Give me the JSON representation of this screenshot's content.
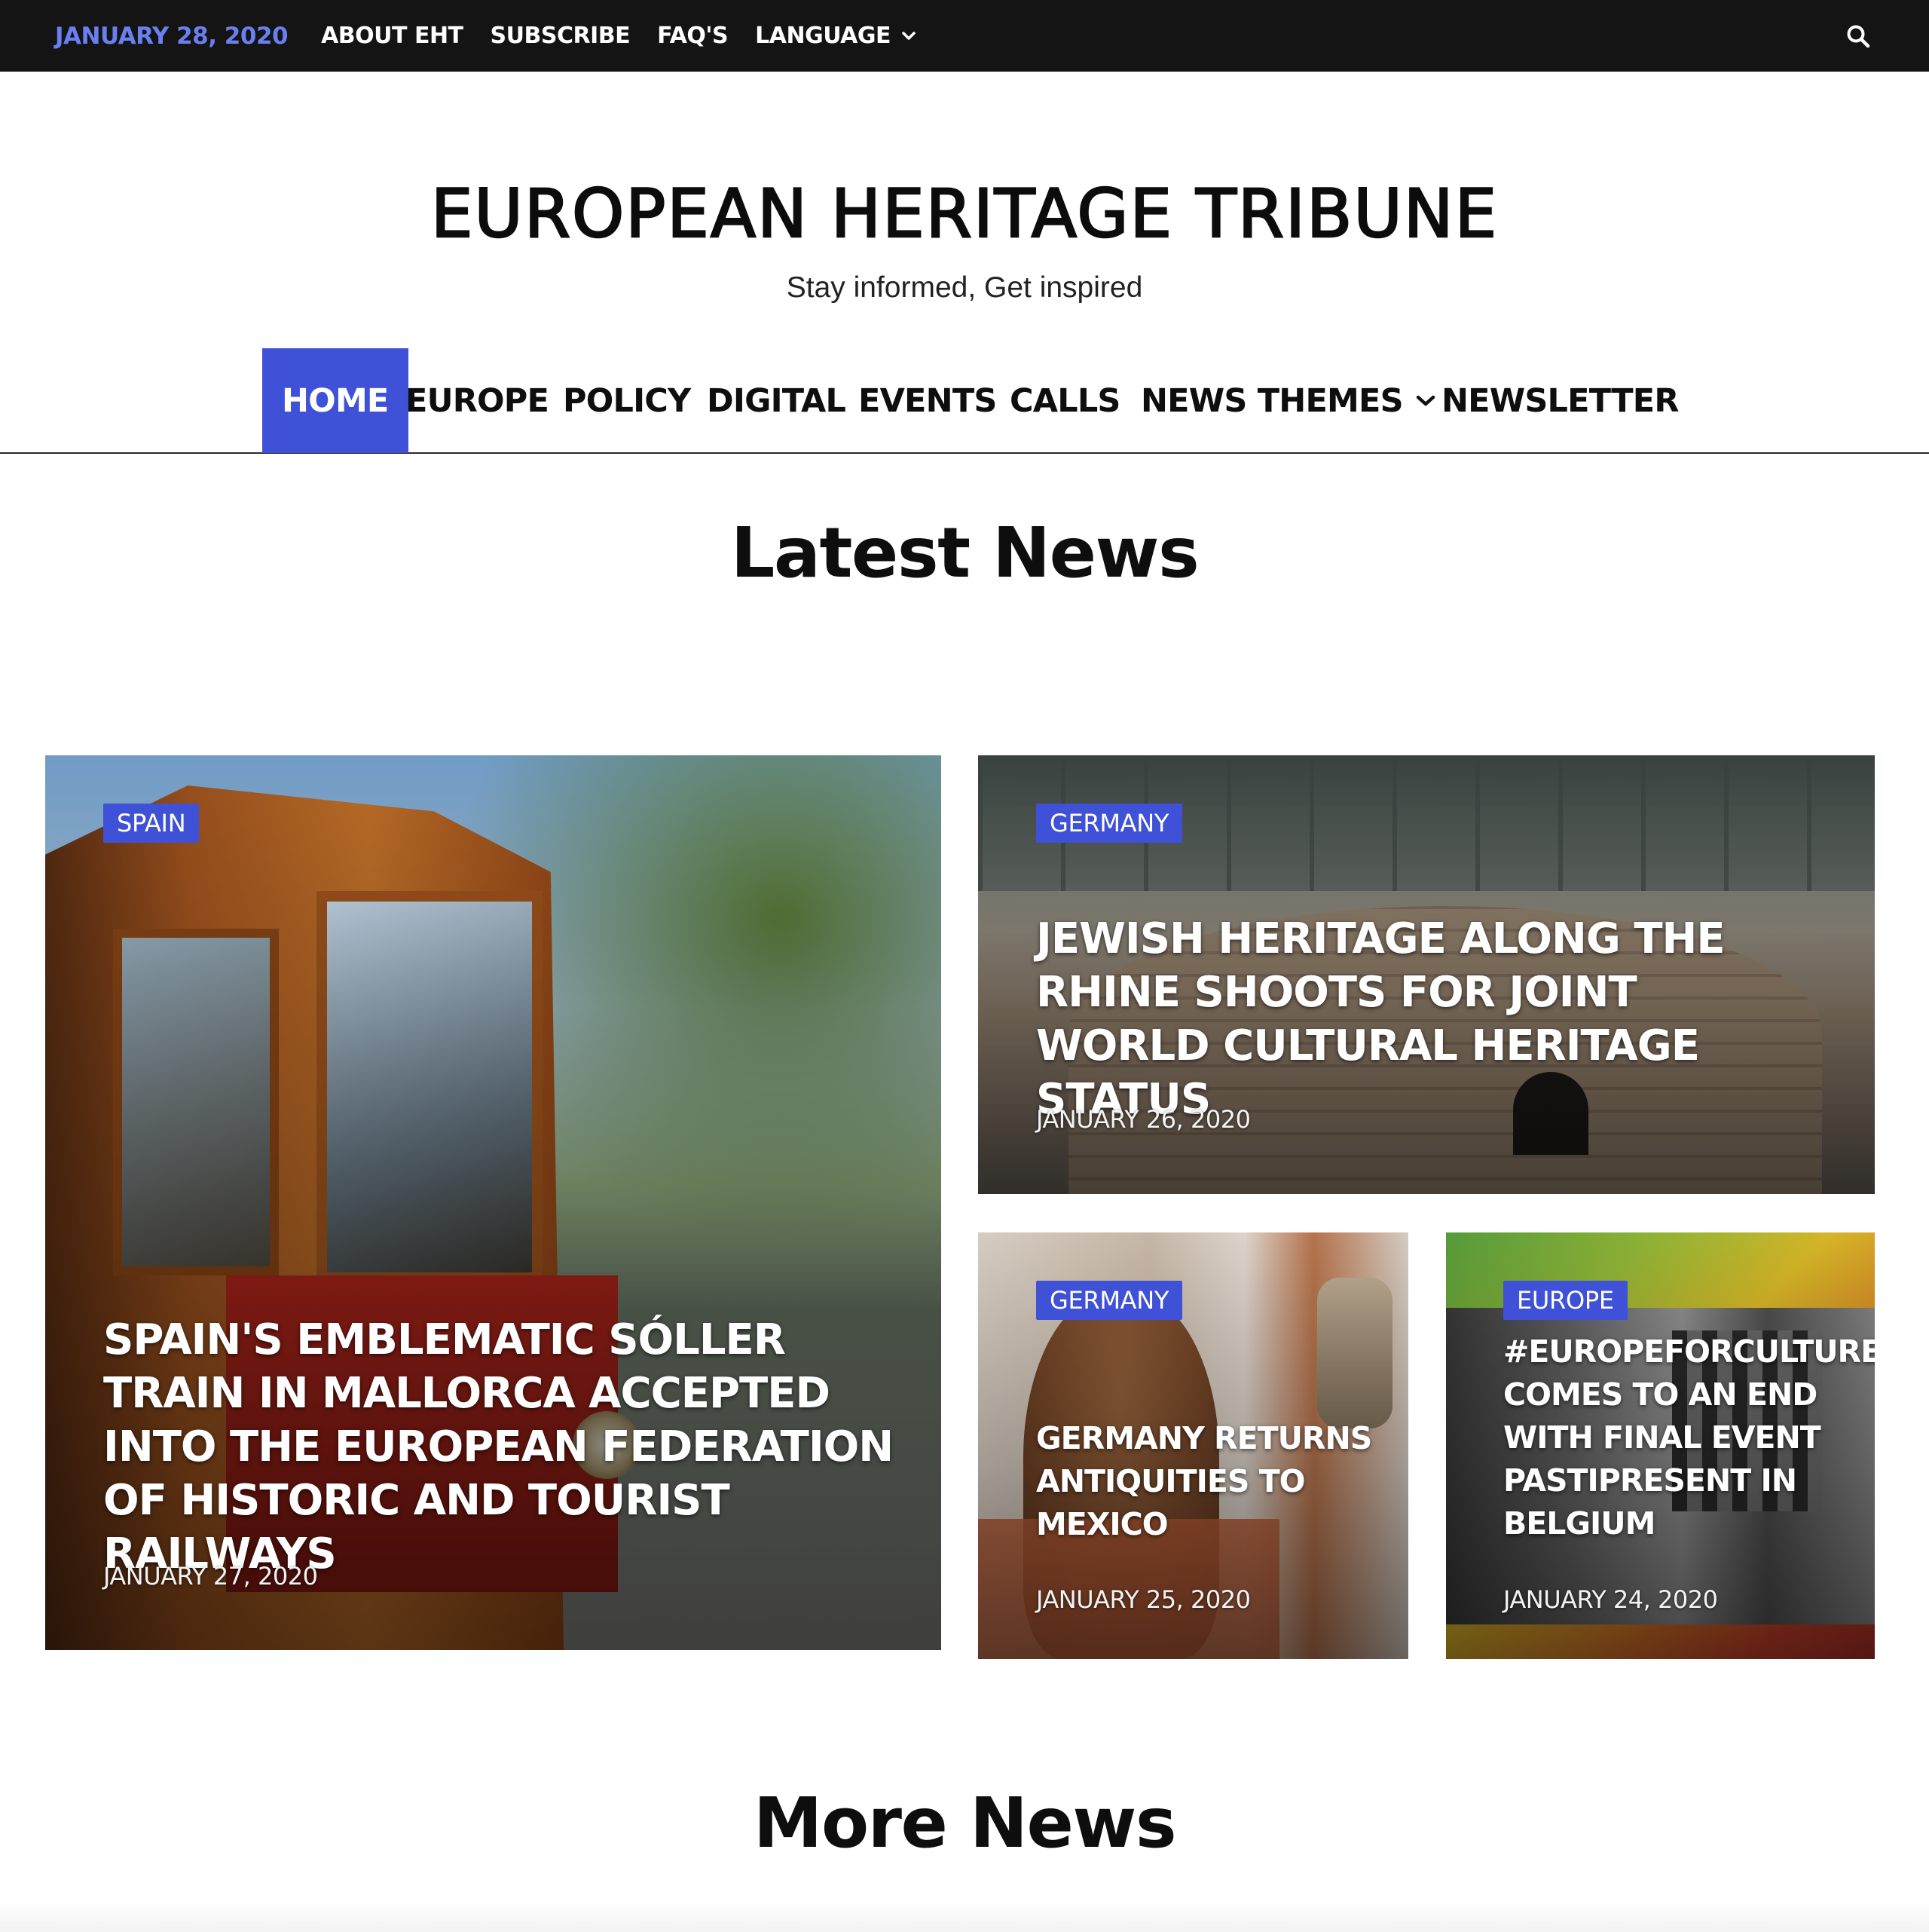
{
  "topbar": {
    "date": "JANUARY 28, 2020",
    "links": [
      "ABOUT EHT",
      "SUBSCRIBE",
      "FAQ'S"
    ],
    "language_label": "LANGUAGE",
    "date_color": "#6a7ff0"
  },
  "masthead": {
    "title": "EUROPEAN HERITAGE TRIBUNE",
    "tagline": "Stay informed, Get inspired"
  },
  "nav": {
    "items": [
      "HOME",
      "EUROPE",
      "POLICY",
      "DIGITAL",
      "EVENTS",
      "CALLS",
      "NEWS THEMES",
      "NEWSLETTER"
    ],
    "active": "HOME",
    "accent": "#3f51d6"
  },
  "latest": {
    "heading": "Latest News",
    "articles": [
      {
        "category": "SPAIN",
        "title": "SPAIN'S EMBLEMATIC SÓLLER TRAIN IN MALLORCA ACCEPTED INTO THE EUROPEAN FEDERATION OF HISTORIC AND TOURIST RAILWAYS",
        "date": "JANUARY 27, 2020"
      },
      {
        "category": "GERMANY",
        "title": "JEWISH HERITAGE ALONG THE RHINE SHOOTS FOR JOINT WORLD CULTURAL HERITAGE STATUS",
        "date": "JANUARY 26, 2020"
      },
      {
        "category": "GERMANY",
        "title": "GERMANY RETURNS ANTIQUITIES TO MEXICO",
        "date": "JANUARY 25, 2020"
      },
      {
        "category": "EUROPE",
        "title": "#EUROPEFORCULTURE COMES TO AN END WITH FINAL EVENT PASTIPRESENT IN BELGIUM",
        "date": "JANUARY 24, 2020"
      }
    ]
  },
  "more": {
    "heading": "More News"
  }
}
